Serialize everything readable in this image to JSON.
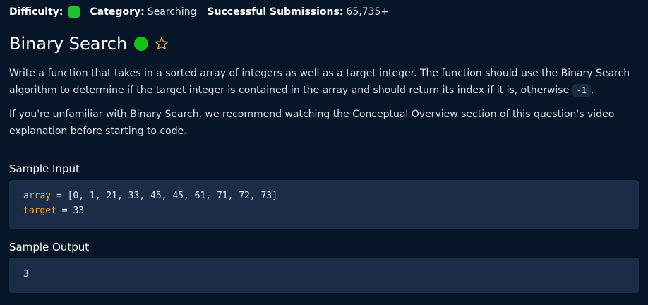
{
  "meta": {
    "difficulty_label": "Difficulty:",
    "category_label": "Category:",
    "category_value": "Searching",
    "submissions_label": "Successful Submissions:",
    "submissions_value": "65,735+"
  },
  "question": {
    "title": "Binary Search",
    "description_p1_before": "Write a function that takes in a sorted array of integers as well as a target integer. The function should use the Binary Search algorithm to determine if the target integer is contained in the array and should return its index if it is, otherwise",
    "description_p1_code": "-1",
    "description_p1_after": ".",
    "description_p2": "If you're unfamiliar with Binary Search, we recommend watching the Conceptual Overview section of this question's video explanation before starting to code."
  },
  "sample_input": {
    "title": "Sample Input",
    "line1_var": "array",
    "line1_op": " = ",
    "line1_value": "[0, 1, 21, 33, 45, 45, 61, 71, 72, 73]",
    "line2_var": "target",
    "line2_op": " = ",
    "line2_value": "33"
  },
  "sample_output": {
    "title": "Sample Output",
    "value": "3"
  },
  "icons": {
    "status": "green-dot",
    "favorite": "star-outline-icon"
  },
  "colors": {
    "background": "#061628",
    "difficulty_easy": "#21c02e",
    "status_dot": "#18c11a",
    "star": "#f2b01e",
    "code_bg": "#1b2d46",
    "variable": "#f1a23b"
  }
}
